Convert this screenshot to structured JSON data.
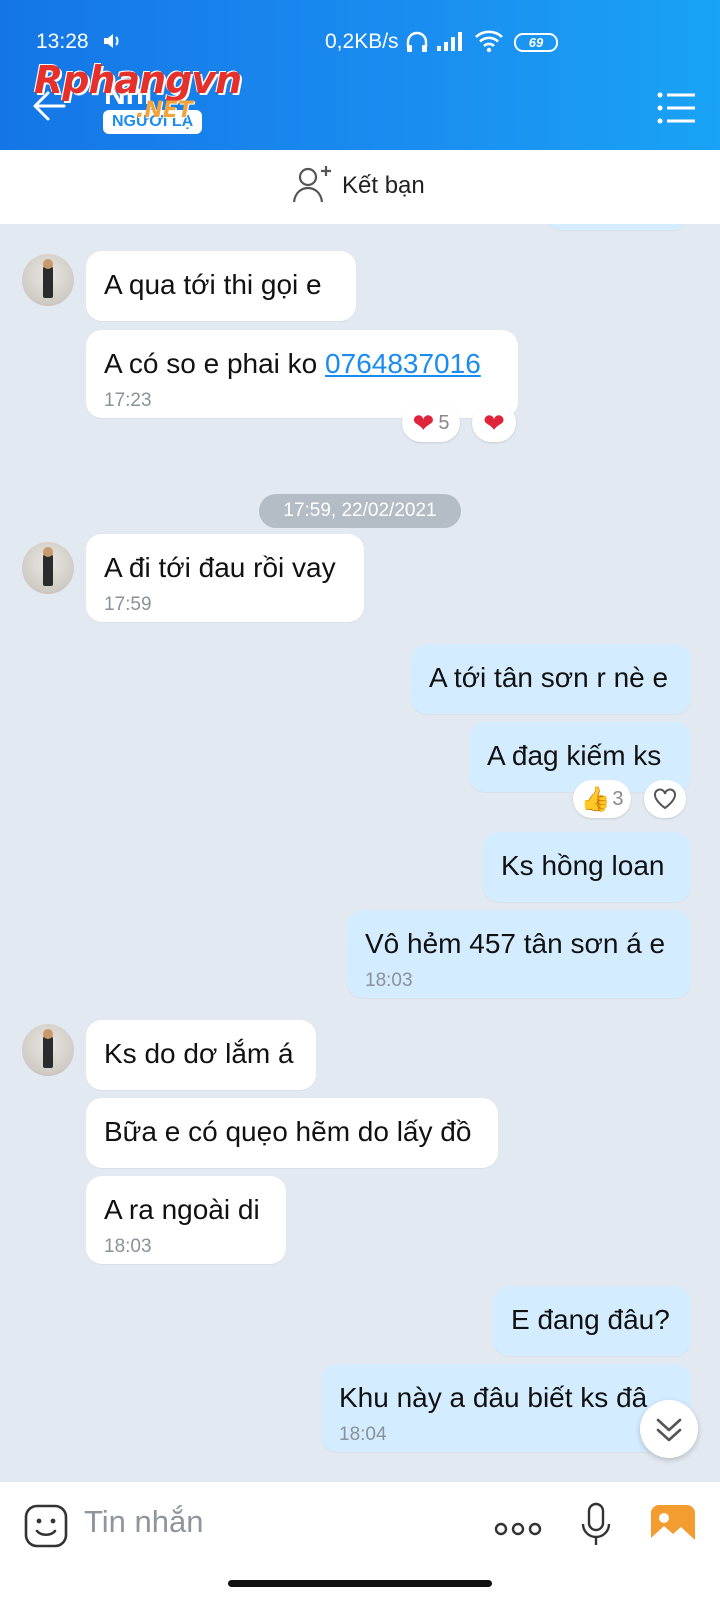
{
  "status_bar": {
    "time": "13:28",
    "net_speed": "0,2KB/s",
    "battery": "69"
  },
  "header": {
    "contact_name": "Nhi",
    "badge": "NGƯỜI LẠ",
    "watermark": "Rphangvn",
    "watermark_sub": ".NET"
  },
  "add_friend": {
    "label": "Kết bạn"
  },
  "messages": {
    "m1": {
      "text": "A qua tới thi gọi e"
    },
    "m2": {
      "text": "A có so e phai ko ",
      "link": "0764837016",
      "time": "17:23"
    },
    "r1": {
      "count": "5"
    },
    "date_divider": "17:59, 22/02/2021",
    "m3": {
      "text": "A đi tới đau rồi vay",
      "time": "17:59"
    },
    "m4": {
      "text": "A tới tân sơn r nè e"
    },
    "m5": {
      "text": "A đag kiếm ks"
    },
    "r2": {
      "count": "3"
    },
    "m6": {
      "text": "Ks hồng loan"
    },
    "m7": {
      "text": "Vô hẻm 457 tân sơn á e",
      "time": "18:03"
    },
    "m8": {
      "text": "Ks do dơ lắm á"
    },
    "m9": {
      "text": "Bữa e có quẹo hẽm do lấy đồ"
    },
    "m10": {
      "text": "A ra ngoài di",
      "time": "18:03"
    },
    "m11": {
      "text": "E đang đâu?"
    },
    "m12": {
      "text": "Khu này a đâu biết ks đâ",
      "time": "18:04"
    }
  },
  "input_bar": {
    "placeholder": "Tin nhắn"
  },
  "colors": {
    "header_gradient_start": "#1476e6",
    "header_gradient_end": "#19a3f5",
    "chat_background": "#e2e9f1",
    "outgoing_bubble": "#d4ecff",
    "incoming_bubble": "#ffffff",
    "link": "#1a8cf0",
    "heart": "#e0243b"
  }
}
